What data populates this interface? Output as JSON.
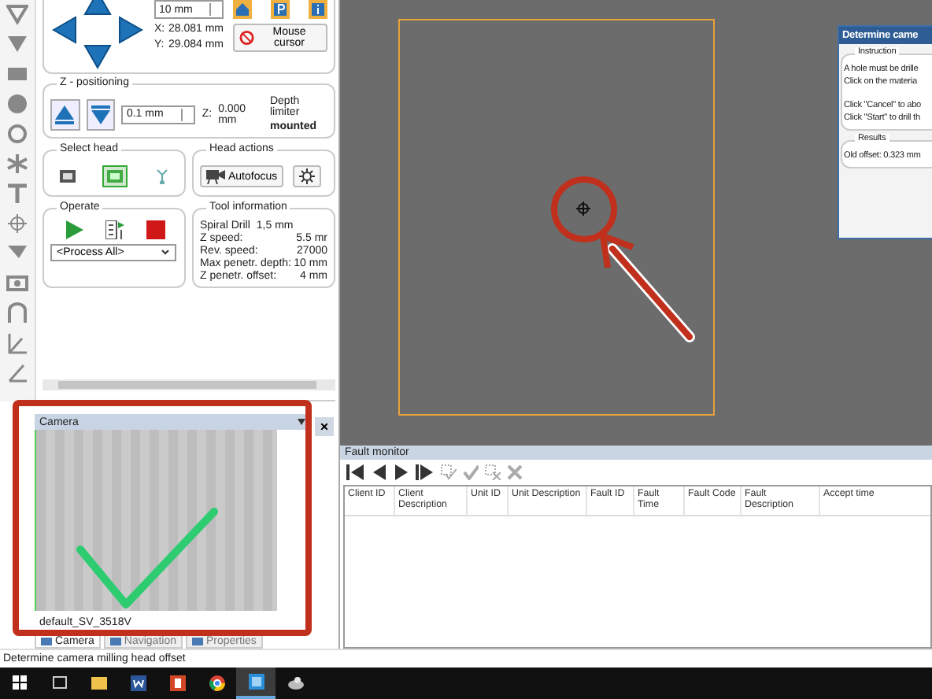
{
  "xy_positioning": {
    "step": "10 mm",
    "x_label": "X:",
    "x_value": "28.081 mm",
    "y_label": "Y:",
    "y_value": "29.084 mm",
    "mouse_button": "Mouse cursor"
  },
  "z_positioning": {
    "title": "Z - positioning",
    "step": "0.1 mm",
    "z_label": "Z:",
    "z_value": "0.000 mm",
    "depth_label": "Depth limiter",
    "depth_value": "mounted"
  },
  "select_head": {
    "title": "Select head",
    "heads": [
      {
        "selected": false
      },
      {
        "selected": true
      },
      {
        "selected": false
      }
    ]
  },
  "head_actions": {
    "title": "Head actions",
    "autofocus": "Autofocus"
  },
  "operate": {
    "title": "Operate",
    "process": "<Process All>"
  },
  "tool_information": {
    "title": "Tool information",
    "tool": "Spiral Drill",
    "size": "1,5 mm",
    "rows": [
      {
        "label": "Z speed:",
        "value": "5.5 mr"
      },
      {
        "label": "Rev. speed:",
        "value": "27000"
      },
      {
        "label": "Max penetr. depth:",
        "value": "10 mm"
      },
      {
        "label": "Z penetr. offset:",
        "value": "4 mm"
      }
    ]
  },
  "camera": {
    "title": "Camera",
    "device": "default_SV_3518V",
    "close": "×"
  },
  "dock_tabs": [
    {
      "label": "Camera",
      "selected": true
    },
    {
      "label": "Navigation",
      "selected": false
    },
    {
      "label": "Properties",
      "selected": false
    }
  ],
  "dialog": {
    "title": "Determine came",
    "instruction_title": "Instruction",
    "paragraphs": [
      [
        "A hole must be drille",
        "Click on the materia"
      ],
      [
        "Click \"Cancel\" to abo",
        "Click \"Start\" to drill th"
      ]
    ],
    "results_title": "Results",
    "old_offset": "Old offset: 0.323 mm"
  },
  "fault_monitor": {
    "title": "Fault monitor",
    "columns": [
      "Client ID",
      "Client Description",
      "Unit ID",
      "Unit Description",
      "Fault ID",
      "Fault Time",
      "Fault Code",
      "Fault Description",
      "Accept time"
    ]
  },
  "status_bar": "Determine camera milling head offset",
  "taskbar": [
    {
      "kind": "start",
      "selected": false
    },
    {
      "kind": "taskview",
      "selected": false
    },
    {
      "kind": "folder",
      "selected": false
    },
    {
      "kind": "word",
      "selected": false
    },
    {
      "kind": "powerpoint",
      "selected": false
    },
    {
      "kind": "chrome",
      "selected": false
    },
    {
      "kind": "app",
      "selected": true
    },
    {
      "kind": "tool",
      "selected": false
    }
  ]
}
